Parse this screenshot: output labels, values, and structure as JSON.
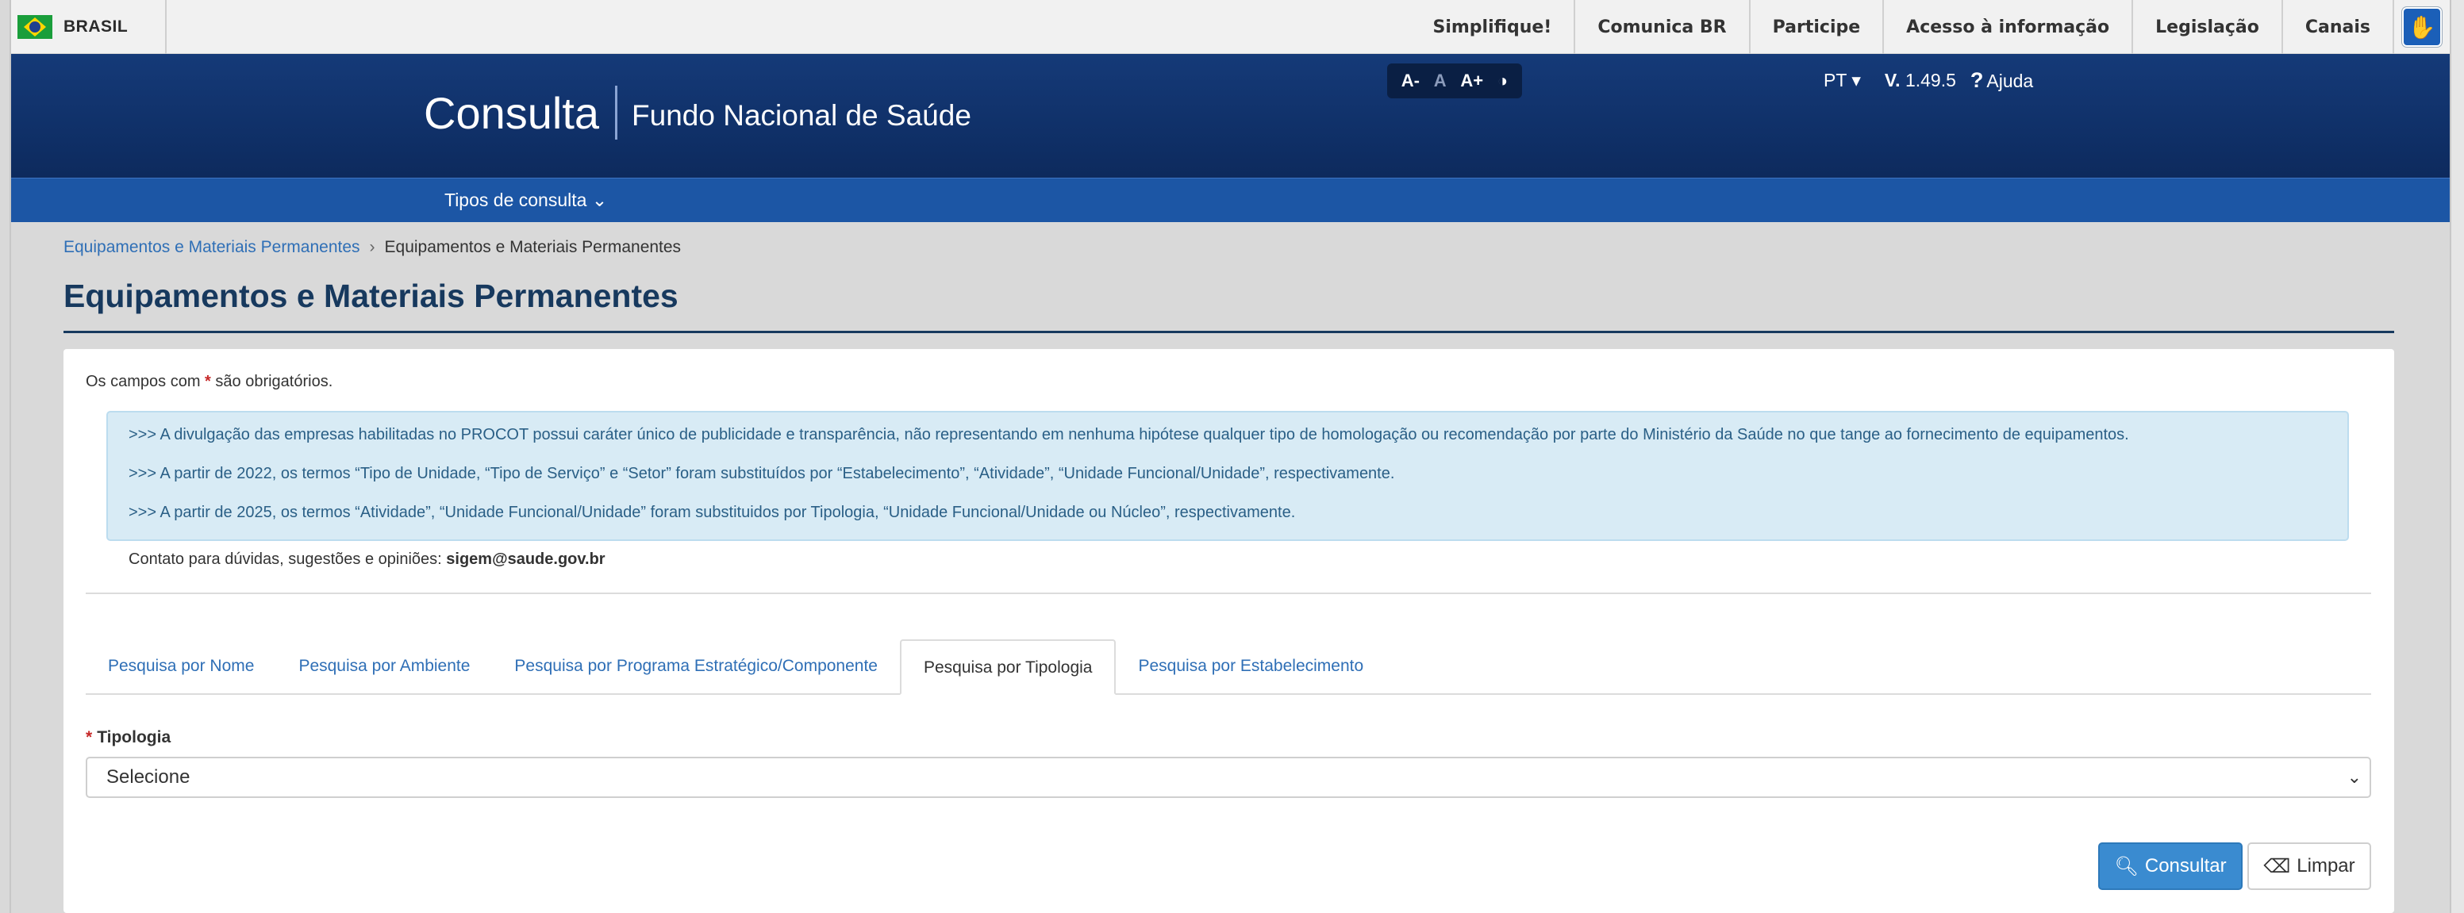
{
  "govbar": {
    "brand": "BRASIL",
    "links": [
      "Simplifique!",
      "Comunica BR",
      "Participe",
      "Acesso à informação",
      "Legislação",
      "Canais"
    ]
  },
  "header": {
    "title": "Consulta",
    "subtitle": "Fundo Nacional de Saúde",
    "font_controls": [
      "A-",
      "A",
      "A+"
    ],
    "language": "PT",
    "version_prefix": "V.",
    "version": "1.49.5",
    "help": "Ajuda"
  },
  "nav": {
    "menu_label": "Tipos de consulta"
  },
  "breadcrumb": {
    "parent": "Equipamentos e Materiais Permanentes",
    "current": "Equipamentos e Materiais Permanentes"
  },
  "page_title": "Equipamentos e Materiais Permanentes",
  "form": {
    "required_prefix": "Os campos com",
    "required_suffix": "são obrigatórios.",
    "notices": [
      ">>> A divulgação das empresas habilitadas no PROCOT possui caráter único de publicidade e transparência, não representando em nenhuma hipótese qualquer tipo de homologação ou recomendação por parte do Ministério da Saúde no que tange ao fornecimento de equipamentos.",
      ">>> A partir de 2022, os termos “Tipo de Unidade, “Tipo de Serviço” e “Setor” foram substituídos por “Estabelecimento”, “Atividade”, “Unidade Funcional/Unidade”, respectivamente.",
      ">>> A partir de 2025, os termos “Atividade”, “Unidade Funcional/Unidade” foram substituidos por Tipologia, “Unidade Funcional/Unidade ou Núcleo”, respectivamente."
    ],
    "contact_label": "Contato para dúvidas, sugestões e opiniões:",
    "contact_email": "sigem@saude.gov.br",
    "tabs": [
      {
        "label": "Pesquisa por Nome"
      },
      {
        "label": "Pesquisa por Ambiente"
      },
      {
        "label": "Pesquisa por Programa Estratégico/Componente"
      },
      {
        "label": "Pesquisa por Tipologia"
      },
      {
        "label": "Pesquisa por Estabelecimento"
      }
    ],
    "active_tab": "Pesquisa por Tipologia",
    "field_label": "Tipologia",
    "select_value": "Selecione",
    "consultar": "Consultar",
    "limpar": "Limpar"
  },
  "colors": {
    "header": "#0f2f66",
    "nav": "#1c56a5",
    "primary_button": "#3a8bd0",
    "title": "#17395e"
  }
}
